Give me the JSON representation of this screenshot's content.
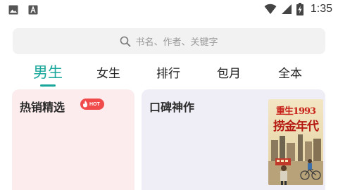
{
  "status_bar": {
    "time": "1:35",
    "left_icons": [
      "image-icon",
      "text-a-icon"
    ],
    "right_icons": [
      "wifi-icon",
      "signal-icon",
      "battery-charging-icon"
    ]
  },
  "search": {
    "placeholder": "书名、作者、关键字",
    "icon": "search-icon"
  },
  "tabs": [
    {
      "label": "男生",
      "active": true
    },
    {
      "label": "女生",
      "active": false
    },
    {
      "label": "排行",
      "active": false
    },
    {
      "label": "包月",
      "active": false
    },
    {
      "label": "全本",
      "active": false
    }
  ],
  "colors": {
    "accent": "#1aa79b",
    "hot_badge": "#f04a4a",
    "card_left_bg": "#fcecee",
    "card_right_bg": "#efeef6"
  },
  "cards": {
    "left": {
      "title": "热销精选",
      "badge": "HOT"
    },
    "right": {
      "title": "口碑神作",
      "cover": {
        "line1": "重生1993",
        "line2": "捞金年代"
      }
    }
  }
}
